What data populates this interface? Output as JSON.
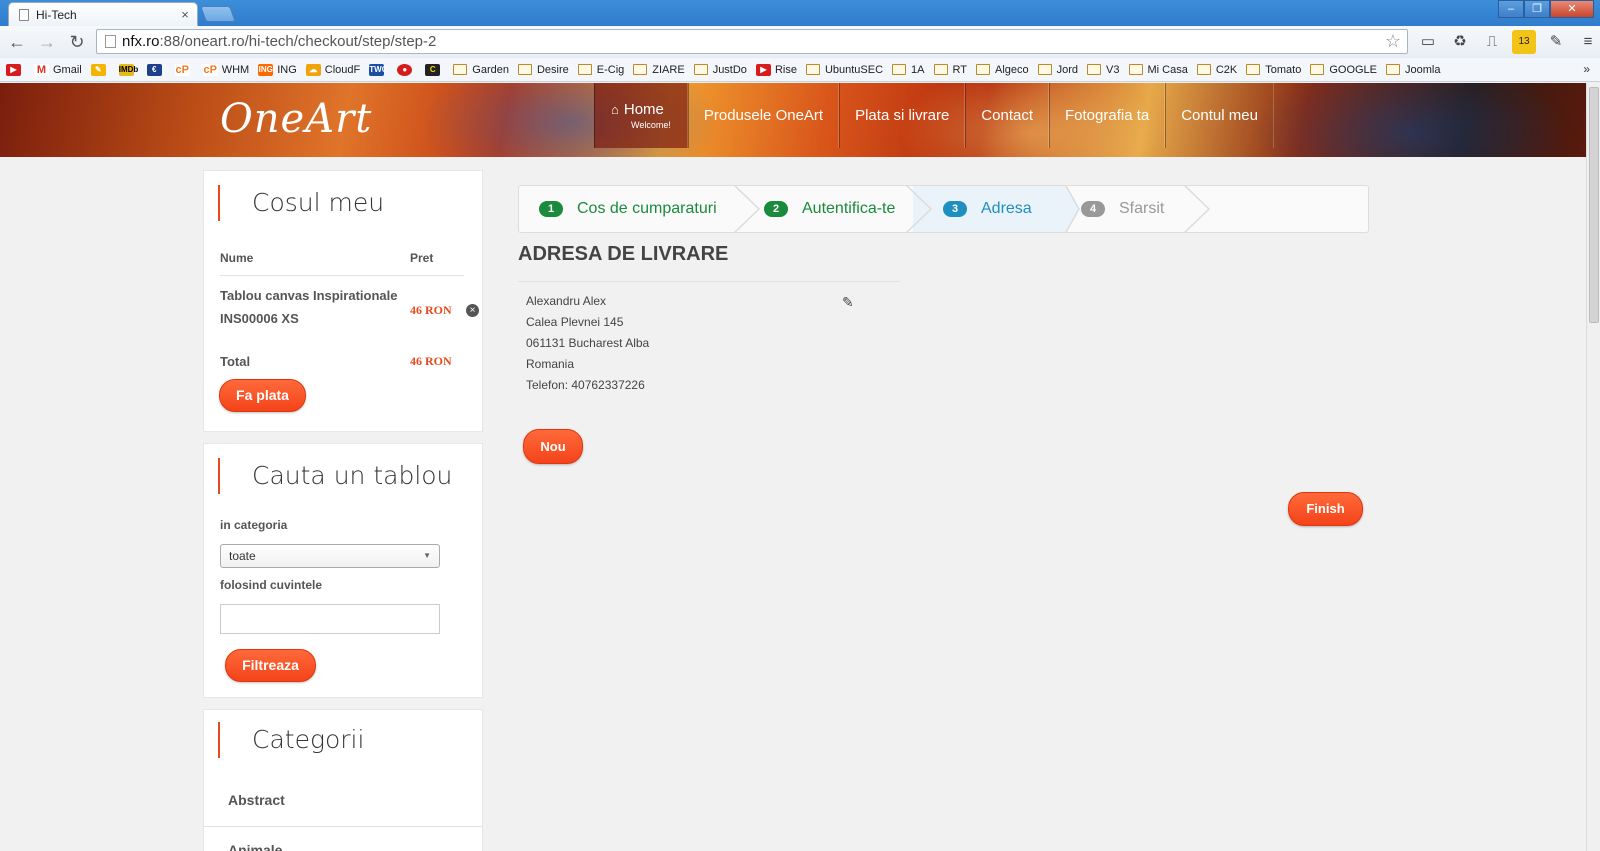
{
  "browser": {
    "tab_title": "Hi-Tech",
    "url_host": "nfx.ro",
    "url_rest": ":88/oneart.ro/hi-tech/checkout/step/step-2",
    "bookmarks": [
      "Gmail",
      "WHM",
      "ING",
      "CloudF",
      "Garden",
      "Desire",
      "E-Cig",
      "ZIARE",
      "JustDo",
      "Rise",
      "UbuntuSEC",
      "1A",
      "RT",
      "Algeco",
      "Jord",
      "V3",
      "Mi Casa",
      "C2K",
      "Tomato",
      "GOOGLE",
      "Joomla"
    ]
  },
  "site": {
    "logo": "OneArt",
    "nav": {
      "home": "Home",
      "home_sub": "Welcome!",
      "produse": "Produsele OneArt",
      "plata": "Plata si livrare",
      "contact": "Contact",
      "foto": "Fotografia ta",
      "cont": "Contul meu"
    }
  },
  "cart": {
    "title": "Cosul meu",
    "col_name": "Nume",
    "col_price": "Pret",
    "item_name": "Tablou canvas Inspirationale INS00006 XS",
    "item_price": "46 RON",
    "total_label": "Total",
    "total_price": "46 RON",
    "pay_button": "Fa plata"
  },
  "search": {
    "title": "Cauta un tablou",
    "category_label": "in categoria",
    "category_value": "toate",
    "words_label": "folosind cuvintele",
    "filter_button": "Filtreaza"
  },
  "categories": {
    "title": "Categorii",
    "items": [
      "Abstract",
      "Animale"
    ]
  },
  "steps": [
    {
      "num": "1",
      "label": "Cos de cumparaturi"
    },
    {
      "num": "2",
      "label": "Autentifica-te"
    },
    {
      "num": "3",
      "label": "Adresa"
    },
    {
      "num": "4",
      "label": "Sfarsit"
    }
  ],
  "address": {
    "title": "ADRESA DE LIVRARE",
    "name": "Alexandru Alex",
    "street": "Calea Plevnei 145",
    "city": "061131 Bucharest Alba",
    "country": "Romania",
    "phone": "Telefon: 40762337226",
    "new_button": "Nou",
    "finish_button": "Finish"
  },
  "colors": {
    "accent": "#f4431a",
    "step_done": "#1a8a3c",
    "step_active": "#1f8fbf",
    "step_todo": "#999999"
  }
}
